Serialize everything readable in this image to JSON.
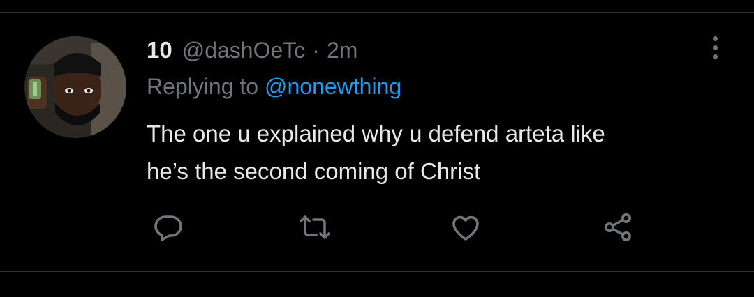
{
  "tweet": {
    "display_name": "10",
    "handle": "@dashOeTc",
    "separator": "·",
    "time": "2m",
    "replying_prefix": "Replying to",
    "replying_to": "@nonewthing",
    "text_line1": "The one u explained why u defend arteta like",
    "text_line2": "he’s the second coming of Christ"
  },
  "actions": {
    "reply_icon": "reply-icon",
    "retweet_icon": "retweet-icon",
    "like_icon": "heart-icon",
    "share_icon": "share-icon"
  },
  "colors": {
    "background": "#000000",
    "text": "#e7e9ea",
    "muted": "#71767b",
    "link": "#1d9bf0",
    "divider": "#2f3336"
  }
}
